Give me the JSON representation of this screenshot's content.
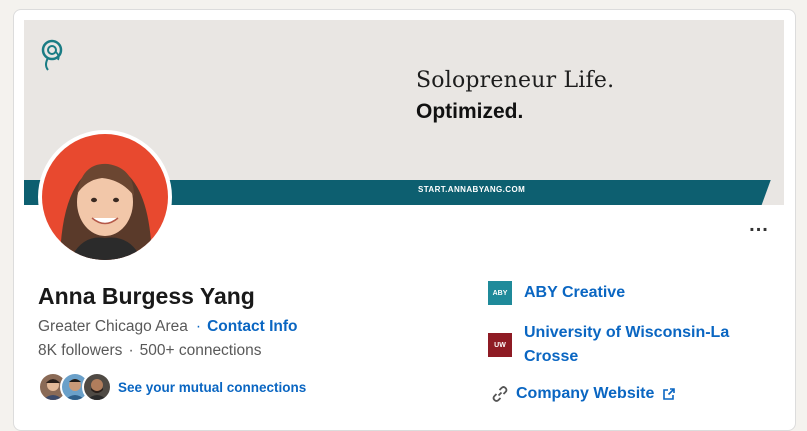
{
  "banner": {
    "line1": "Solopreneur Life.",
    "line2": "Optimized.",
    "url": "START.ANNABYANG.COM",
    "logo_icon": "spiral-leaf-logo",
    "accent_color": "#0d5f70"
  },
  "profile": {
    "name": "Anna Burgess Yang",
    "location": "Greater Chicago Area",
    "contact_label": "Contact Info",
    "followers": "8K followers",
    "connections": "500+ connections",
    "mutual_label": "See your mutual connections",
    "more_label": "..."
  },
  "experience": {
    "company": "ABY Creative",
    "company_logo_text": "ABY",
    "education_line1": "University of Wisconsin-La",
    "education_line2": "Crosse",
    "education_logo_text": "UW",
    "website_label": "Company Website"
  },
  "colors": {
    "link": "#0a66c2",
    "avatar_bg": "#e8492f"
  }
}
